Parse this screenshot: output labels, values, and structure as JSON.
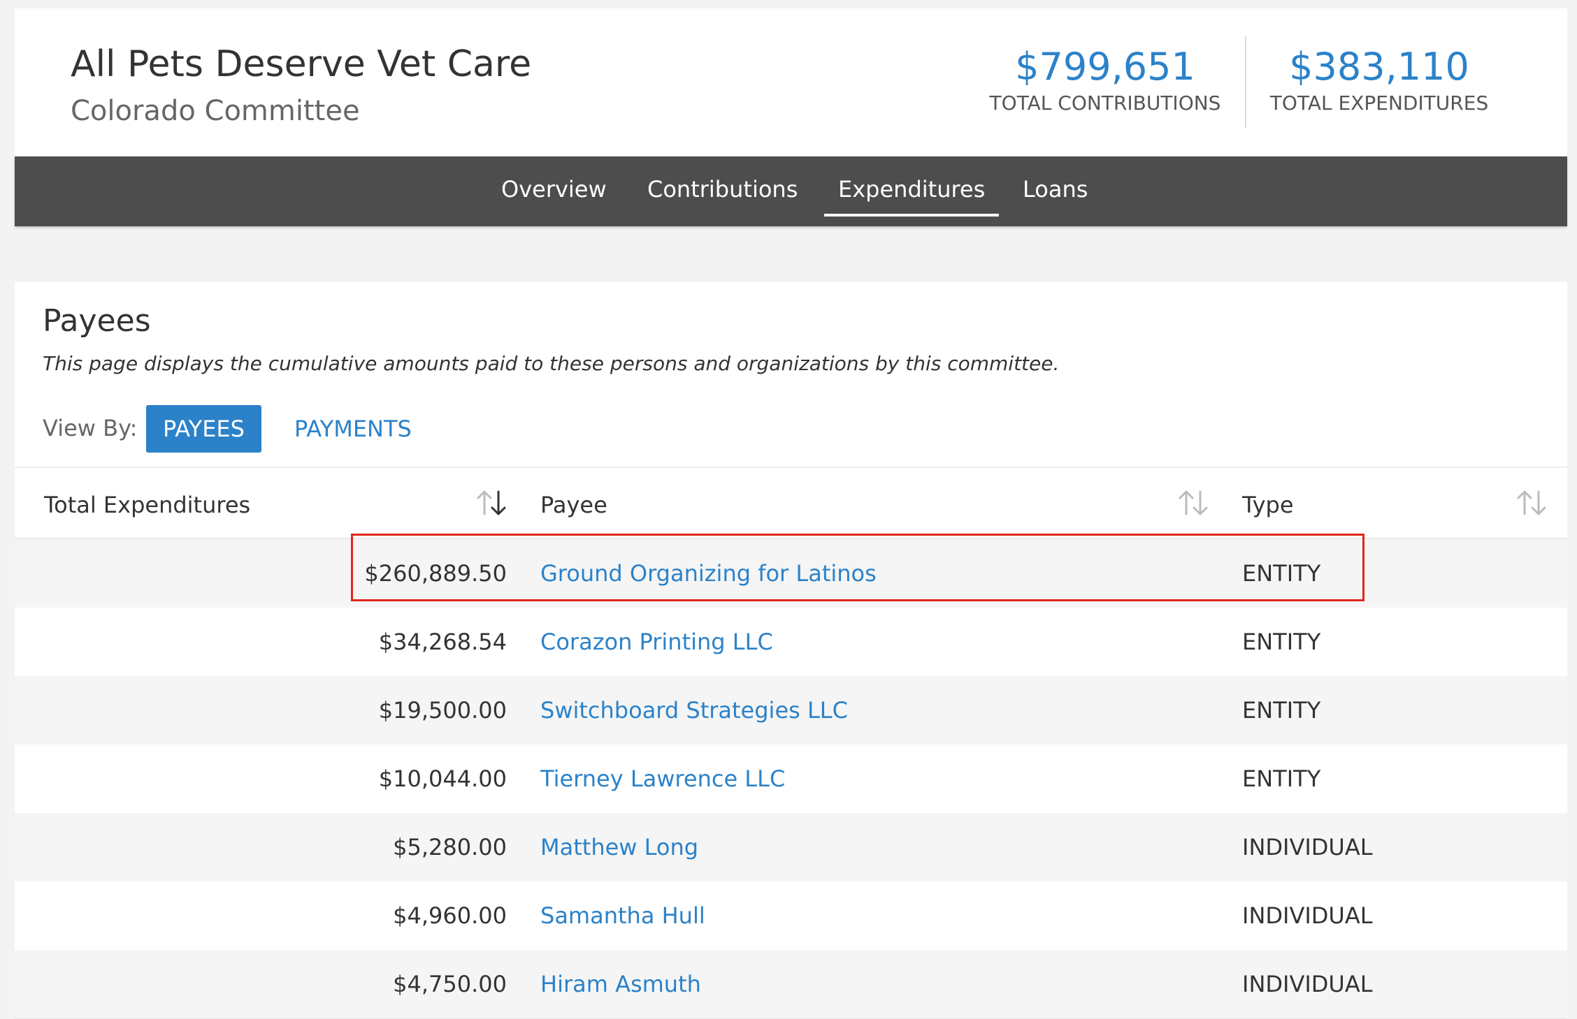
{
  "committee": {
    "name": "All Pets Deserve Vet Care",
    "subtitle": "Colorado Committee"
  },
  "stats": {
    "contributions_value": "$799,651",
    "contributions_label": "TOTAL CONTRIBUTIONS",
    "expenditures_value": "$383,110",
    "expenditures_label": "TOTAL EXPENDITURES"
  },
  "nav": {
    "items": [
      {
        "label": "Overview"
      },
      {
        "label": "Contributions"
      },
      {
        "label": "Expenditures",
        "active": true
      },
      {
        "label": "Loans"
      }
    ]
  },
  "payees_section": {
    "title": "Payees",
    "description": "This page displays the cumulative amounts paid to these persons and organizations by this committee.",
    "view_by_label": "View By:",
    "view_by_options": [
      "PAYEES",
      "PAYMENTS"
    ],
    "view_by_selected": "PAYEES"
  },
  "table": {
    "columns": [
      "Total Expenditures",
      "Payee",
      "Type"
    ],
    "sorted_column": "Total Expenditures",
    "sort_direction": "descending",
    "rows": [
      {
        "amount": "$260,889.50",
        "payee": "Ground Organizing for Latinos",
        "type": "ENTITY",
        "highlighted": true
      },
      {
        "amount": "$34,268.54",
        "payee": "Corazon Printing LLC",
        "type": "ENTITY"
      },
      {
        "amount": "$19,500.00",
        "payee": "Switchboard Strategies LLC",
        "type": "ENTITY"
      },
      {
        "amount": "$10,044.00",
        "payee": "Tierney Lawrence LLC",
        "type": "ENTITY"
      },
      {
        "amount": "$5,280.00",
        "payee": "Matthew Long",
        "type": "INDIVIDUAL"
      },
      {
        "amount": "$4,960.00",
        "payee": "Samantha Hull",
        "type": "INDIVIDUAL"
      },
      {
        "amount": "$4,750.00",
        "payee": "Hiram Asmuth",
        "type": "INDIVIDUAL"
      }
    ]
  },
  "colors": {
    "accent": "#2b82c9",
    "navbar": "#4d4d4d",
    "highlight": "#e0261b",
    "row_alt": "#f5f5f5"
  }
}
